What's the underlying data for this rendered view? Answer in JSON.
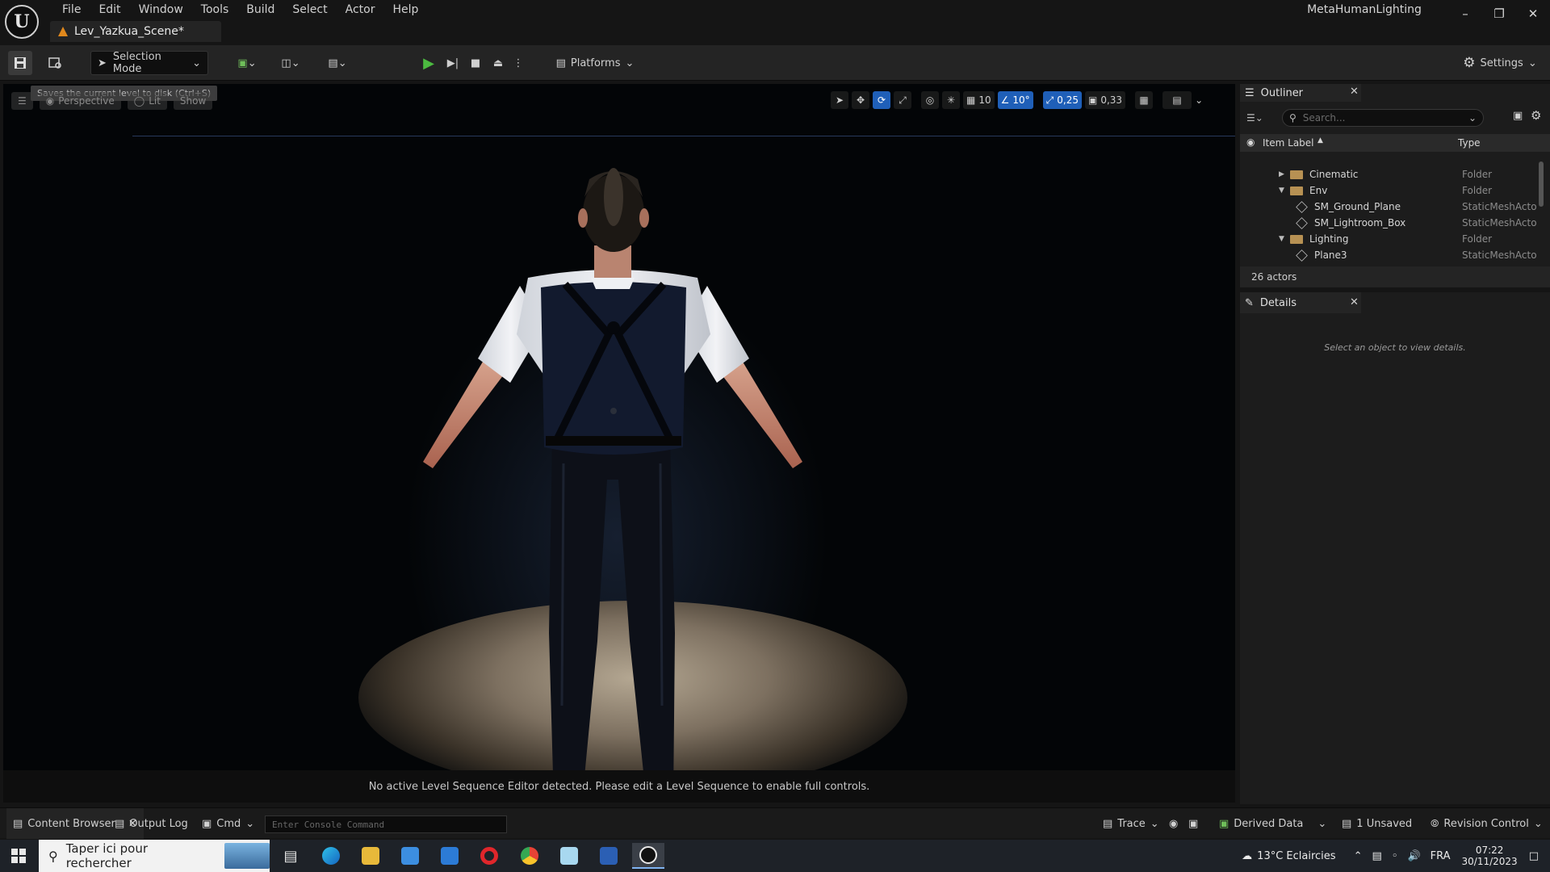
{
  "app": {
    "project_name": "MetaHumanLighting",
    "level_tab": "Lev_Yazkua_Scene*",
    "menu": [
      "File",
      "Edit",
      "Window",
      "Tools",
      "Build",
      "Select",
      "Actor",
      "Help"
    ]
  },
  "toolbar": {
    "selection_mode": "Selection Mode",
    "platforms": "Platforms",
    "settings": "Settings"
  },
  "viewport": {
    "tooltip": "Saves the current level to disk (Ctrl+S)",
    "perspective": "Perspective",
    "lit": "Lit",
    "show": "Show",
    "grid_snap": "10",
    "rotation_snap": "10°",
    "scale_snap": "0,25",
    "camera_speed": "0,33",
    "sequencer_message": "No active Level Sequence Editor detected. Please edit a Level Sequence to enable full controls."
  },
  "outliner": {
    "title": "Outliner",
    "search_placeholder": "Search...",
    "col_label": "Item Label",
    "col_type": "Type",
    "rows": [
      {
        "label": "Cinematic",
        "type": "Folder"
      },
      {
        "label": "Env",
        "type": "Folder"
      },
      {
        "label": "SM_Ground_Plane",
        "type": "StaticMeshActo"
      },
      {
        "label": "SM_Lightroom_Box",
        "type": "StaticMeshActo"
      },
      {
        "label": "Lighting",
        "type": "Folder"
      },
      {
        "label": "Plane3",
        "type": "StaticMeshActo"
      }
    ],
    "actor_count": "26 actors"
  },
  "details": {
    "title": "Details",
    "hint": "Select an object to view details."
  },
  "statusbar": {
    "content_browser": "Content Browser",
    "output_log": "Output Log",
    "cmd": "Cmd",
    "console_placeholder": "Enter Console Command",
    "trace": "Trace",
    "derived_data": "Derived Data",
    "unsaved": "1 Unsaved",
    "revision_control": "Revision Control"
  },
  "taskbar": {
    "search_placeholder": "Taper ici pour rechercher",
    "weather": "13°C  Eclaircies",
    "language": "FRA",
    "time": "07:22",
    "date": "30/11/2023"
  },
  "colors": {
    "accent": "#1f5fb8",
    "play_green": "#4cbb40",
    "folder": "#b79153"
  }
}
